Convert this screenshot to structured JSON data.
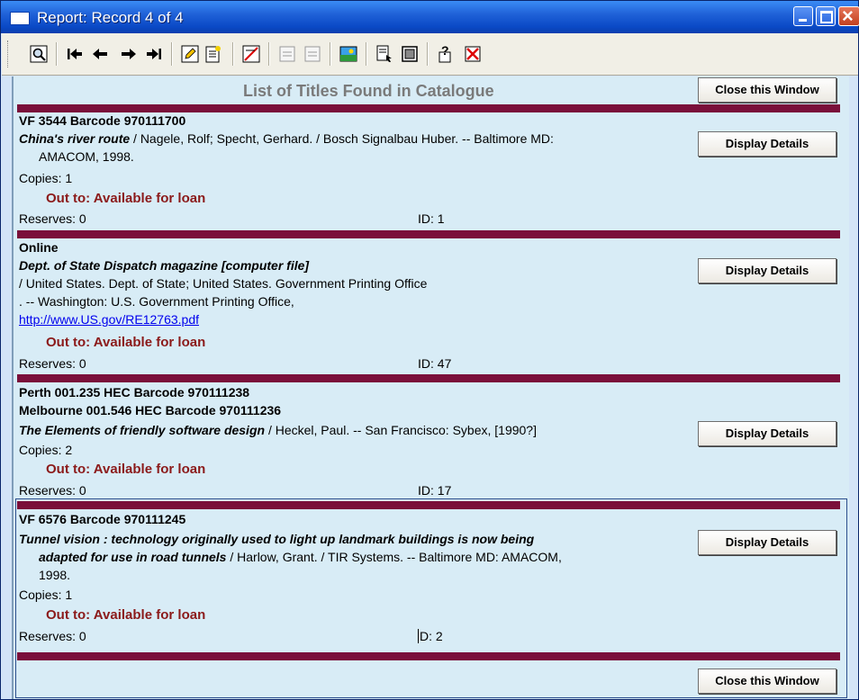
{
  "window": {
    "title": "Report: Record 4 of 4"
  },
  "toolbar": {
    "buttons": [
      "zoom-icon",
      "first-record-icon",
      "prev-record-icon",
      "next-record-icon",
      "last-record-icon",
      "edit-icon",
      "new-record-icon",
      "delete-icon",
      "import-icon",
      "export-icon",
      "picture-icon",
      "report-icon",
      "layout-icon",
      "help-icon",
      "close-report-icon"
    ]
  },
  "header": {
    "title": "List of Titles Found in Catalogue",
    "close_label": "Close this Window"
  },
  "footer": {
    "close_label": "Close this Window"
  },
  "records": [
    {
      "call": "VF 3544 Barcode 970111700",
      "title": "China's river route",
      "rest1": " / Nagele, Rolf; Specht, Gerhard. / Bosch Signalbau Huber.  -- Baltimore MD:",
      "rest2": "AMACOM, 1998.",
      "copies": "Copies: 1",
      "loan": "Out to: Available for loan",
      "reserves": "Reserves: 0",
      "id": "ID: 1",
      "details": "Display Details"
    },
    {
      "call": "Online",
      "title": "Dept. of State Dispatch magazine [computer file]",
      "rest1": "/ United States.  Dept. of State; United States.  Government Printing Office",
      "rest2": ".  -- Washington: U.S. Government Printing Office,",
      "link": "http://www.US.gov/RE12763.pdf",
      "loan": "Out to: Available for loan",
      "reserves": "Reserves: 0",
      "id": "ID: 47",
      "details": "Display Details"
    },
    {
      "call": "Perth 001.235 HEC Barcode 970111238",
      "call2": "Melbourne 001.546 HEC Barcode 970111236",
      "title": "The Elements of friendly software design",
      "rest1": " / Heckel, Paul.  -- San Francisco: Sybex, [1990?]",
      "copies": "Copies: 2",
      "loan": "Out to: Available for loan",
      "reserves": "Reserves: 0",
      "id": "ID: 17",
      "details": "Display Details"
    },
    {
      "call": "VF 6576 Barcode 970111245",
      "title": "Tunnel vision : technology originally used to light up landmark buildings is now being",
      "title2": "adapted for use in road tunnels",
      "rest1": " / Harlow, Grant. / TIR Systems.  -- Baltimore MD: AMACOM,",
      "rest2": "1998.",
      "copies": "Copies: 1",
      "loan": "Out to: Available for loan",
      "reserves": "Reserves: 0",
      "id_text": "D: 2",
      "details": "Display Details"
    }
  ]
}
